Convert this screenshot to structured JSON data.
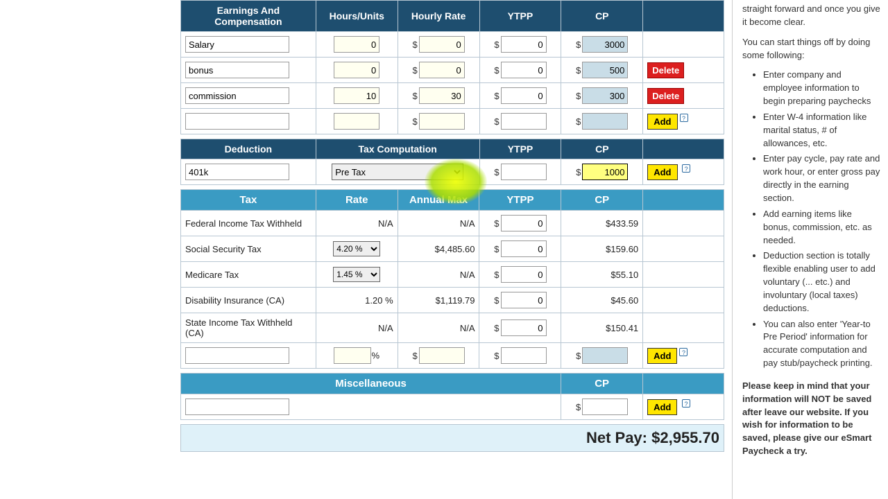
{
  "earnings": {
    "headers": [
      "Earnings And Compensation",
      "Hours/Units",
      "Hourly Rate",
      "YTPP",
      "CP"
    ],
    "rows": [
      {
        "name": "Salary",
        "hours": "0",
        "rate": "0",
        "ytpp": "0",
        "cp": "3000",
        "actions": []
      },
      {
        "name": "bonus",
        "hours": "0",
        "rate": "0",
        "ytpp": "0",
        "cp": "500",
        "actions": [
          "delete"
        ]
      },
      {
        "name": "commission",
        "hours": "10",
        "rate": "30",
        "ytpp": "0",
        "cp": "300",
        "actions": [
          "delete"
        ]
      }
    ],
    "blank": {
      "name": "",
      "hours": "",
      "rate": "",
      "ytpp": "",
      "cp": ""
    }
  },
  "deduction": {
    "headers": [
      "Deduction",
      "Tax Computation",
      "YTPP",
      "CP"
    ],
    "row": {
      "name": "401k",
      "tax": "Pre Tax",
      "ytpp": "",
      "cp": "1000"
    }
  },
  "tax": {
    "headers": [
      "Tax",
      "Rate",
      "Annual Max",
      "YTPP",
      "CP"
    ],
    "rows": [
      {
        "name": "Federal Income Tax Withheld",
        "rate": "N/A",
        "rate_sel": false,
        "max": "N/A",
        "ytpp": "0",
        "cp": "$433.59"
      },
      {
        "name": "Social Security Tax",
        "rate": "4.20 %",
        "rate_sel": true,
        "max": "$4,485.60",
        "ytpp": "0",
        "cp": "$159.60"
      },
      {
        "name": "Medicare Tax",
        "rate": "1.45 %",
        "rate_sel": true,
        "max": "N/A",
        "ytpp": "0",
        "cp": "$55.10"
      },
      {
        "name": "Disability Insurance (CA)",
        "rate": "1.20 %",
        "rate_sel": false,
        "max": "$1,119.79",
        "ytpp": "0",
        "cp": "$45.60"
      },
      {
        "name": "State Income Tax Withheld (CA)",
        "rate": "N/A",
        "rate_sel": false,
        "max": "N/A",
        "ytpp": "0",
        "cp": "$150.41"
      }
    ],
    "blank": {
      "name": "",
      "rate": "",
      "max": "",
      "ytpp": "",
      "cp": ""
    }
  },
  "misc": {
    "headers": [
      "Miscellaneous",
      "CP"
    ],
    "row": {
      "name": "",
      "cp": ""
    }
  },
  "buttons": {
    "add": "Add",
    "delete": "Delete"
  },
  "netpay": {
    "label": "Net Pay:",
    "amount": "$2,955.70"
  },
  "sidebar": {
    "p0": "straight forward and once you give it become clear.",
    "p1": "You can start things off by doing some following:",
    "items": [
      "Enter company and employee information to begin preparing paychecks",
      "Enter W-4 information like marital status, # of allowances, etc.",
      "Enter pay cycle, pay rate and work hour, or enter gross pay directly in the earning section.",
      "Add earning items like bonus, commission, etc. as needed.",
      "Deduction section is totally flexible enabling user to add voluntary (... etc.) and involuntary (local taxes) deductions.",
      "You can also enter 'Year-to Pre Period' information for accurate computation and pay stub/paycheck printing."
    ],
    "p2": "Please keep in mind that your information will NOT be saved after leave our website. If you wish for information to be saved, please give our eSmart Paycheck a try."
  }
}
